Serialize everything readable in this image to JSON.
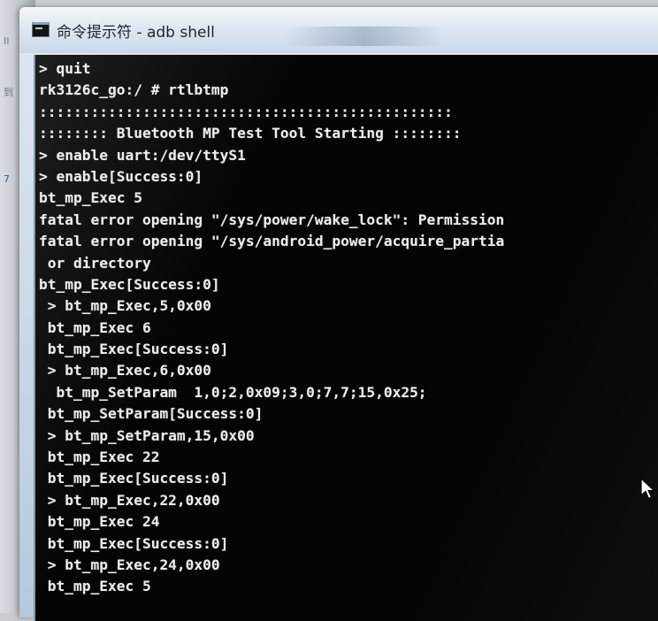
{
  "window": {
    "title": "命令提示符 - adb  shell"
  },
  "console": {
    "lines": [
      "> quit",
      "rk3126c_go:/ # rtlbtmp",
      "::::::::::::::::::::::::::::::::::::::::::::::::",
      ":::::::: Bluetooth MP Test Tool Starting ::::::::",
      "> enable uart:/dev/ttyS1",
      "> enable[Success:0]",
      "bt_mp_Exec 5",
      "fatal error opening \"/sys/power/wake_lock\": Permission",
      "fatal error opening \"/sys/android_power/acquire_partia",
      " or directory",
      "bt_mp_Exec[Success:0]",
      " > bt_mp_Exec,5,0x00",
      " bt_mp_Exec 6",
      " bt_mp_Exec[Success:0]",
      " > bt_mp_Exec,6,0x00",
      "  bt_mp_SetParam  1,0;2,0x09;3,0;7,7;15,0x25;",
      " bt_mp_SetParam[Success:0]",
      " > bt_mp_SetParam,15,0x00",
      " bt_mp_Exec 22",
      " bt_mp_Exec[Success:0]",
      " > bt_mp_Exec,22,0x00",
      " bt_mp_Exec 24",
      " bt_mp_Exec[Success:0]",
      " > bt_mp_Exec,24,0x00",
      " bt_mp_Exec 5"
    ]
  },
  "icons": {
    "app": "console-icon",
    "pointer": "mouse-pointer-icon"
  }
}
